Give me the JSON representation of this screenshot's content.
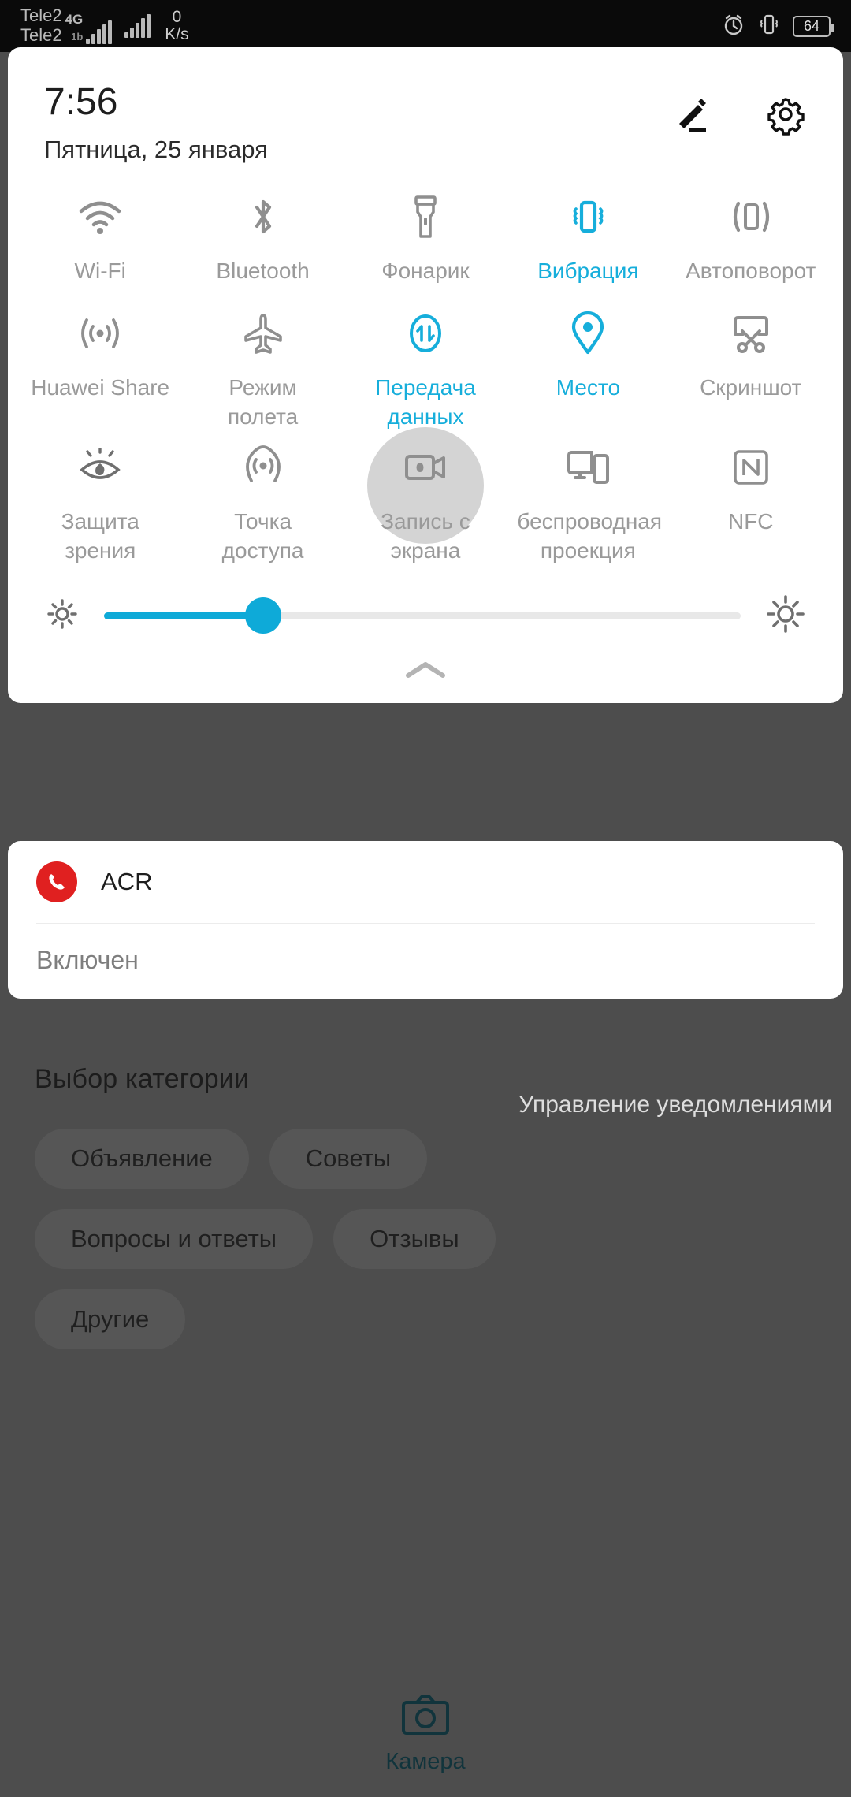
{
  "statusbar": {
    "carrier_1": "Tele2",
    "carrier_2": "Tele2",
    "net_badge_1": "4G",
    "net_badge_2": "1b",
    "speed_value": "0",
    "speed_unit": "K/s",
    "battery_percent": "64",
    "icons": [
      "alarm-icon",
      "vibrate-icon",
      "battery-icon"
    ]
  },
  "quick_settings": {
    "time": "7:56",
    "date": "Пятница, 25 января",
    "edit_label": "edit-icon",
    "settings_label": "gear-icon",
    "accent_color": "#16aedb",
    "inactive_color": "#9a9a9a",
    "tiles": [
      {
        "label": "Wi-Fi",
        "icon": "wifi-icon",
        "active": false
      },
      {
        "label": "Bluetooth",
        "icon": "bluetooth-icon",
        "active": false
      },
      {
        "label": "Фонарик",
        "icon": "flashlight-icon",
        "active": false
      },
      {
        "label": "Вибрация",
        "icon": "vibrate-icon",
        "active": true
      },
      {
        "label": "Автоповорот",
        "icon": "autorotate-icon",
        "active": false
      },
      {
        "label": "Huawei Share",
        "icon": "huawei-share-icon",
        "active": false
      },
      {
        "label": "Режим полета",
        "icon": "airplane-icon",
        "active": false
      },
      {
        "label": "Передача данных",
        "icon": "mobile-data-icon",
        "active": true
      },
      {
        "label": "Место",
        "icon": "location-pin-icon",
        "active": true
      },
      {
        "label": "Скриншот",
        "icon": "screenshot-icon",
        "active": false
      },
      {
        "label": "Защита зрения",
        "icon": "eye-comfort-icon",
        "active": false
      },
      {
        "label": "Точка доступа",
        "icon": "hotspot-icon",
        "active": false
      },
      {
        "label": "Запись с экрана",
        "icon": "screen-record-icon",
        "active": false,
        "pressed": true
      },
      {
        "label": "беспроводная проекция",
        "icon": "cast-icon",
        "active": false
      },
      {
        "label": "NFC",
        "icon": "nfc-icon",
        "active": false
      }
    ],
    "brightness": {
      "low_icon": "brightness-low-icon",
      "high_icon": "brightness-high-icon",
      "value_percent": 25
    },
    "expand_icon": "chevron-up-icon"
  },
  "notification": {
    "app_name": "ACR",
    "icon": "phone-record-icon",
    "body": "Включен"
  },
  "background": {
    "title": "Выбор категории",
    "manage_link": "Управление уведомлениями",
    "chip_rows": [
      [
        "Объявление",
        "Советы"
      ],
      [
        "Вопросы и ответы",
        "Отзывы"
      ],
      [
        "Другие"
      ]
    ],
    "dock": {
      "label": "Камера",
      "icon": "camera-icon"
    }
  }
}
